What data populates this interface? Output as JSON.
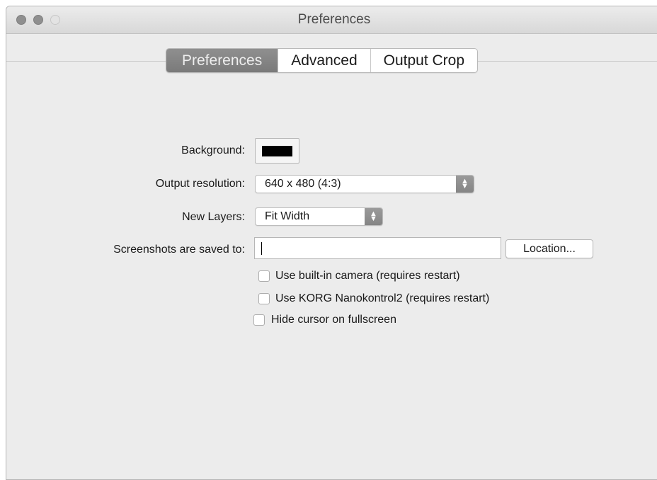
{
  "window": {
    "title": "Preferences"
  },
  "tabs": [
    {
      "label": "Preferences",
      "selected": true
    },
    {
      "label": "Advanced",
      "selected": false
    },
    {
      "label": "Output Crop",
      "selected": false
    }
  ],
  "form": {
    "background_label": "Background:",
    "background_color": "#000000",
    "resolution_label": "Output resolution:",
    "resolution_value": "640 x 480 (4:3)",
    "layers_label": "New Layers:",
    "layers_value": "Fit Width",
    "screenshots_label": "Screenshots are saved to:",
    "screenshots_path": "",
    "location_button": "Location..."
  },
  "checkboxes": [
    {
      "label": "Use built-in camera (requires restart)",
      "checked": false
    },
    {
      "label": "Use KORG Nanokontrol2 (requires restart)",
      "checked": false
    },
    {
      "label": "Hide cursor on fullscreen",
      "checked": false
    }
  ],
  "icons": {
    "stepper": "up-down-chevron-icon"
  }
}
